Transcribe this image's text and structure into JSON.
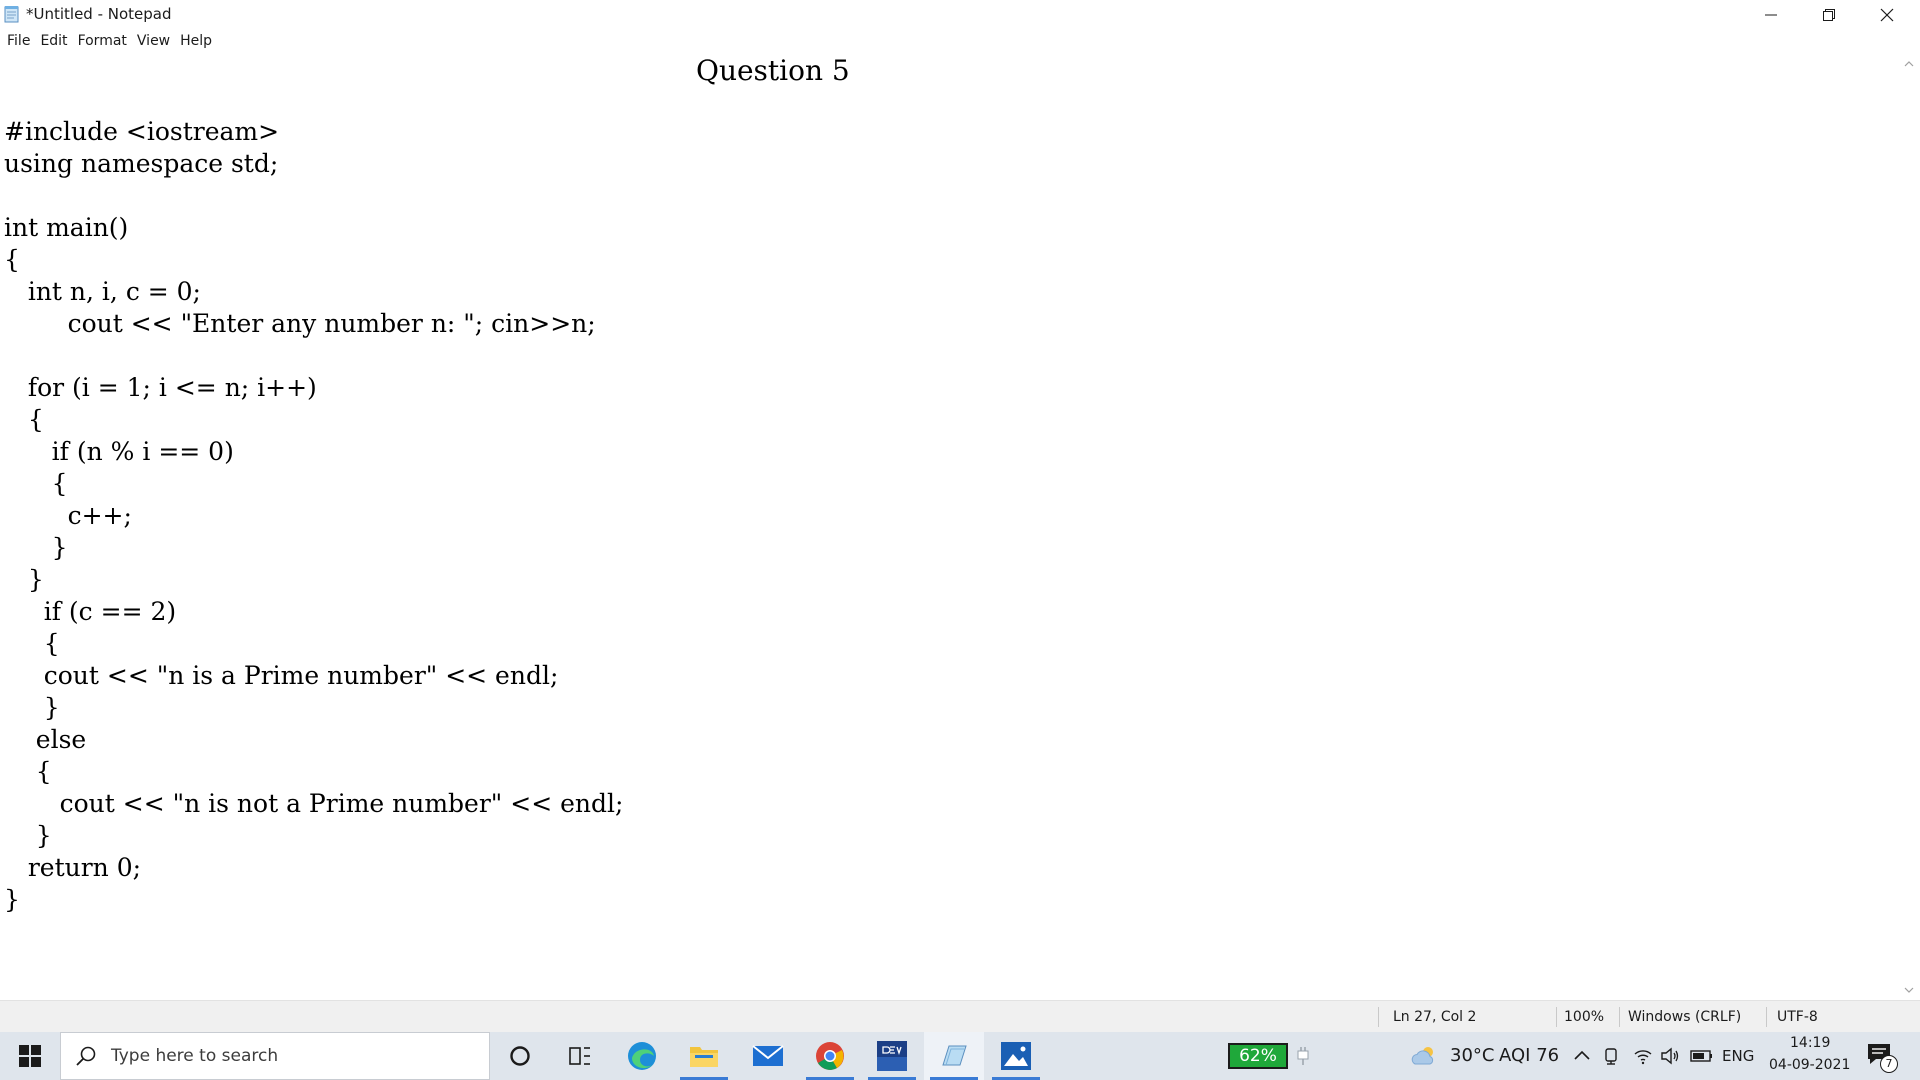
{
  "window": {
    "title": "*Untitled - Notepad",
    "controls": [
      "minimize-icon",
      "restore-icon",
      "close-icon"
    ]
  },
  "menu": {
    "items": [
      "File",
      "Edit",
      "Format",
      "View",
      "Help"
    ]
  },
  "document": {
    "heading": "Question 5",
    "lines": [
      "#include <iostream>",
      "using namespace std;",
      "",
      "int main()",
      "{",
      "   int n, i, c = 0;",
      "        cout << \"Enter any number n: \"; cin>>n;",
      "",
      "   for (i = 1; i <= n; i++)",
      "   {",
      "      if (n % i == 0)",
      "      {",
      "        c++;",
      "      }",
      "   }",
      "     if (c == 2)",
      "     {",
      "     cout << \"n is a Prime number\" << endl;",
      "     }",
      "    else",
      "    {",
      "       cout << \"n is not a Prime number\" << endl;",
      "    }",
      "   return 0;",
      "}"
    ]
  },
  "statusbar": {
    "position": "Ln 27, Col 2",
    "zoom": "100%",
    "line_ending": "Windows (CRLF)",
    "encoding": "UTF-8"
  },
  "taskbar": {
    "search_placeholder": "Type here to search",
    "apps": [
      "cortana-icon",
      "task-view-icon",
      "edge-icon",
      "file-explorer-icon",
      "mail-icon",
      "chrome-icon",
      "devcpp-icon",
      "notepad-icon",
      "photos-icon"
    ],
    "battery_percent": "62%",
    "weather": "30°C",
    "aqi": "AQI 76",
    "language": "ENG",
    "time": "14:19",
    "date": "04-09-2021",
    "notification_count": "7"
  },
  "colors": {
    "taskbar_bg": "#dfe5ec",
    "battery_green": "#1fa83a",
    "active_underline": "#3a7bd5"
  }
}
